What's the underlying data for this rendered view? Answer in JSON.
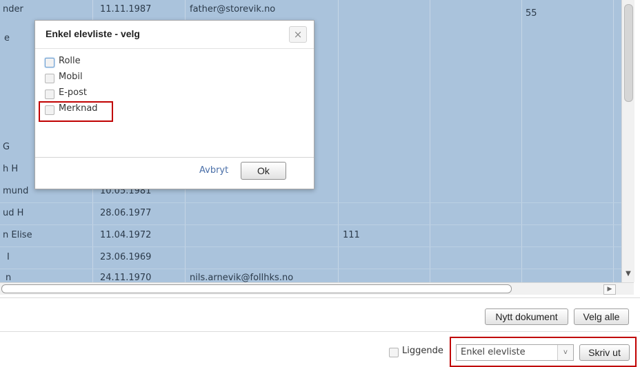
{
  "grid": {
    "rows": [
      {
        "name": "nder",
        "date": "11.11.1987",
        "email": "father@storevik.no",
        "c4": "",
        "c5": "55"
      },
      {
        "name": "e",
        "date": "",
        "email": "",
        "c4": "",
        "c5": ""
      },
      {
        "name": "",
        "date": "",
        "email": "",
        "c4": "",
        "c5": ""
      },
      {
        "name": "",
        "date": "",
        "email": "",
        "c4": "",
        "c5": ""
      },
      {
        "name": "",
        "date": "",
        "email": "",
        "c4": "",
        "c5": ""
      },
      {
        "name": "",
        "date": "",
        "email": "",
        "c4": "",
        "c5": ""
      },
      {
        "name": "G",
        "date": "",
        "email": "",
        "c4": "",
        "c5": ""
      },
      {
        "name": "h H",
        "date": "",
        "email": "",
        "c4": "",
        "c5": ""
      },
      {
        "name": "mund",
        "date": "10.05.1981",
        "email": "",
        "c4": "",
        "c5": ""
      },
      {
        "name": "ud H",
        "date": "28.06.1977",
        "email": "",
        "c4": "",
        "c5": ""
      },
      {
        "name": "n Elise",
        "date": "11.04.1972",
        "email": "",
        "c4": "111",
        "c5": ""
      },
      {
        "name": "I",
        "date": "23.06.1969",
        "email": "",
        "c4": "",
        "c5": ""
      },
      {
        "name": "n",
        "date": "24.11.1970",
        "email": "nils.arnevik@follhks.no",
        "c4": "",
        "c5": ""
      }
    ]
  },
  "scroll": {
    "down_arrow": "▼",
    "right_arrow": "▶"
  },
  "toolbar": {
    "new_document_label": "Nytt dokument",
    "select_all_label": "Velg alle"
  },
  "footer": {
    "landscape_label": "Liggende",
    "report_select_value": "Enkel elevliste",
    "dropdown_arrow": "v",
    "print_label": "Skriv ut"
  },
  "dialog": {
    "title": "Enkel elevliste - velg",
    "close_symbol": "×",
    "options": [
      "Rolle",
      "Mobil",
      "E-post",
      "Merknad"
    ],
    "cancel_label": "Avbryt",
    "ok_label": "Ok"
  }
}
